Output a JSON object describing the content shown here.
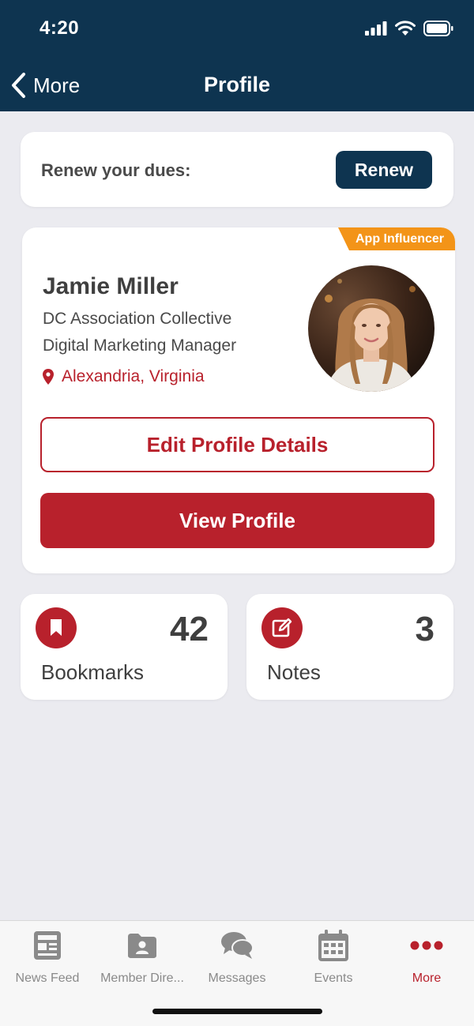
{
  "status": {
    "time": "4:20"
  },
  "nav": {
    "back_label": "More",
    "title": "Profile"
  },
  "renew": {
    "text": "Renew your dues:",
    "button": "Renew"
  },
  "profile": {
    "badge": "App Influencer",
    "name": "Jamie Miller",
    "organization": "DC Association Collective",
    "title": "Digital Marketing Manager",
    "location": "Alexandria, Virginia",
    "edit_button": "Edit Profile Details",
    "view_button": "View Profile"
  },
  "stats": [
    {
      "label": "Bookmarks",
      "value": "42",
      "icon": "bookmark-icon"
    },
    {
      "label": "Notes",
      "value": "3",
      "icon": "edit-note-icon"
    }
  ],
  "tabs": [
    {
      "label": "News Feed",
      "icon": "newspaper-icon",
      "active": false
    },
    {
      "label": "Member Dire...",
      "icon": "member-folder-icon",
      "active": false
    },
    {
      "label": "Messages",
      "icon": "chat-bubbles-icon",
      "active": false
    },
    {
      "label": "Events",
      "icon": "calendar-icon",
      "active": false
    },
    {
      "label": "More",
      "icon": "more-dots-icon",
      "active": true
    }
  ],
  "colors": {
    "header": "#0e3450",
    "accent_red": "#b8212c",
    "badge_orange": "#f39418",
    "background": "#ebebf0"
  }
}
